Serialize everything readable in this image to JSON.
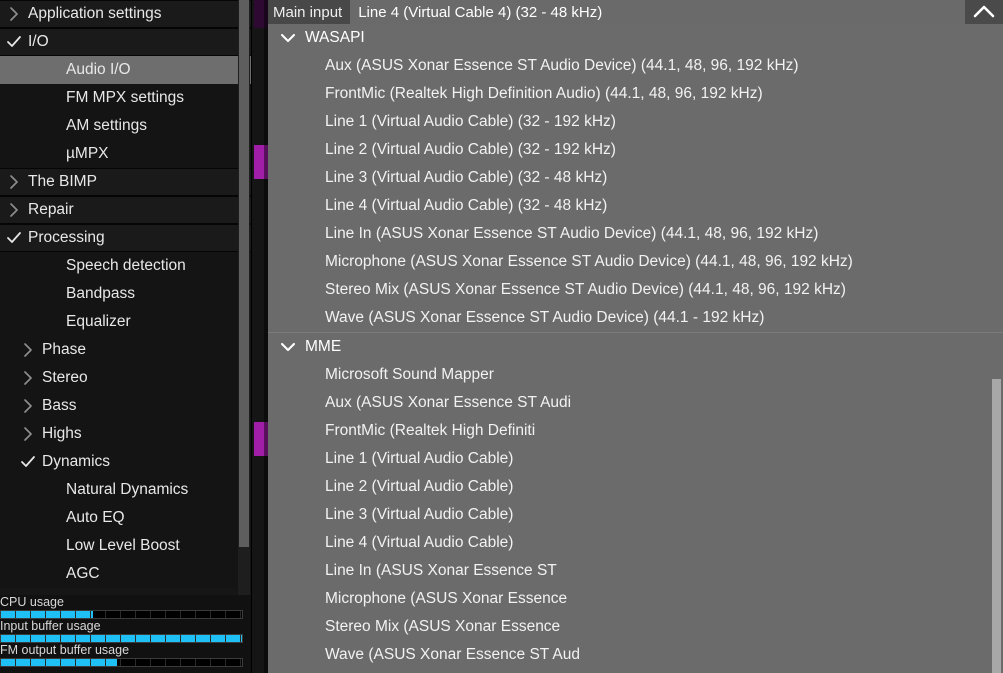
{
  "sidebar": {
    "items": [
      {
        "label": "Application settings",
        "indent": 0,
        "state": "collapsed",
        "type": "group",
        "selected": false
      },
      {
        "label": "I/O",
        "indent": 0,
        "state": "expanded",
        "type": "group",
        "selected": false
      },
      {
        "label": "Audio I/O",
        "indent": 2,
        "state": "none",
        "type": "child",
        "selected": true
      },
      {
        "label": "FM MPX settings",
        "indent": 2,
        "state": "none",
        "type": "child",
        "selected": false
      },
      {
        "label": "AM settings",
        "indent": 2,
        "state": "none",
        "type": "child",
        "selected": false
      },
      {
        "label": "µMPX",
        "indent": 2,
        "state": "none",
        "type": "child",
        "selected": false
      },
      {
        "label": "The BIMP",
        "indent": 0,
        "state": "collapsed",
        "type": "group",
        "selected": false
      },
      {
        "label": "Repair",
        "indent": 0,
        "state": "collapsed",
        "type": "group",
        "selected": false
      },
      {
        "label": "Processing",
        "indent": 0,
        "state": "expanded",
        "type": "group",
        "selected": false
      },
      {
        "label": "Speech detection",
        "indent": 2,
        "state": "none",
        "type": "child",
        "selected": false
      },
      {
        "label": "Bandpass",
        "indent": 2,
        "state": "none",
        "type": "child",
        "selected": false
      },
      {
        "label": "Equalizer",
        "indent": 2,
        "state": "none",
        "type": "child",
        "selected": false
      },
      {
        "label": "Phase",
        "indent": 1,
        "state": "collapsed",
        "type": "child",
        "selected": false
      },
      {
        "label": "Stereo",
        "indent": 1,
        "state": "collapsed",
        "type": "child",
        "selected": false
      },
      {
        "label": "Bass",
        "indent": 1,
        "state": "collapsed",
        "type": "child",
        "selected": false
      },
      {
        "label": "Highs",
        "indent": 1,
        "state": "collapsed",
        "type": "child",
        "selected": false
      },
      {
        "label": "Dynamics",
        "indent": 1,
        "state": "expanded",
        "type": "child",
        "selected": false
      },
      {
        "label": "Natural Dynamics",
        "indent": 2,
        "state": "none",
        "type": "child",
        "selected": false
      },
      {
        "label": "Auto EQ",
        "indent": 2,
        "state": "none",
        "type": "child",
        "selected": false
      },
      {
        "label": "Low Level Boost",
        "indent": 2,
        "state": "none",
        "type": "child",
        "selected": false
      },
      {
        "label": "AGC",
        "indent": 2,
        "state": "none",
        "type": "child",
        "selected": false
      }
    ]
  },
  "meters": {
    "accent_color": "#1ec0f5",
    "items": [
      {
        "label": "CPU usage",
        "percent": 38
      },
      {
        "label": "Input buffer usage",
        "percent": 100
      },
      {
        "label": "FM output buffer usage",
        "percent": 48
      }
    ]
  },
  "dropdown": {
    "field_label": "Main input",
    "selected_value": "Line 4 (Virtual Cable 4) (32 - 48 kHz)",
    "collapse_icon": "chevron-up-icon",
    "groups": [
      {
        "name": "WASAPI",
        "state": "expanded",
        "items": [
          "Aux (ASUS Xonar Essence ST Audio Device) (44.1, 48, 96, 192 kHz)",
          "FrontMic (Realtek High Definition Audio) (44.1, 48, 96, 192 kHz)",
          "Line 1 (Virtual Audio Cable) (32 - 192 kHz)",
          "Line 2 (Virtual Audio Cable) (32 - 192 kHz)",
          "Line 3 (Virtual Audio Cable) (32 - 48 kHz)",
          "Line 4 (Virtual Audio Cable) (32 - 48 kHz)",
          "Line In (ASUS Xonar Essence ST Audio Device) (44.1, 48, 96, 192 kHz)",
          "Microphone (ASUS Xonar Essence ST Audio Device) (44.1, 48, 96, 192 kHz)",
          "Stereo Mix (ASUS Xonar Essence ST Audio Device) (44.1, 48, 96, 192 kHz)",
          "Wave (ASUS Xonar Essence ST Audio Device) (44.1 - 192 kHz)"
        ]
      },
      {
        "name": "MME",
        "state": "expanded",
        "items": [
          "Microsoft Sound Mapper",
          "Aux (ASUS Xonar Essence ST Audi",
          "FrontMic (Realtek High Definiti",
          "Line 1 (Virtual Audio Cable)",
          "Line 2 (Virtual Audio Cable)",
          "Line 3 (Virtual Audio Cable)",
          "Line 4 (Virtual Audio Cable)",
          "Line In (ASUS Xonar Essence ST",
          "Microphone (ASUS Xonar Essence",
          "Stereo Mix (ASUS Xonar Essence",
          "Wave (ASUS Xonar Essence ST Aud"
        ]
      }
    ]
  },
  "background": {
    "accent_color": "#a01ea8"
  }
}
